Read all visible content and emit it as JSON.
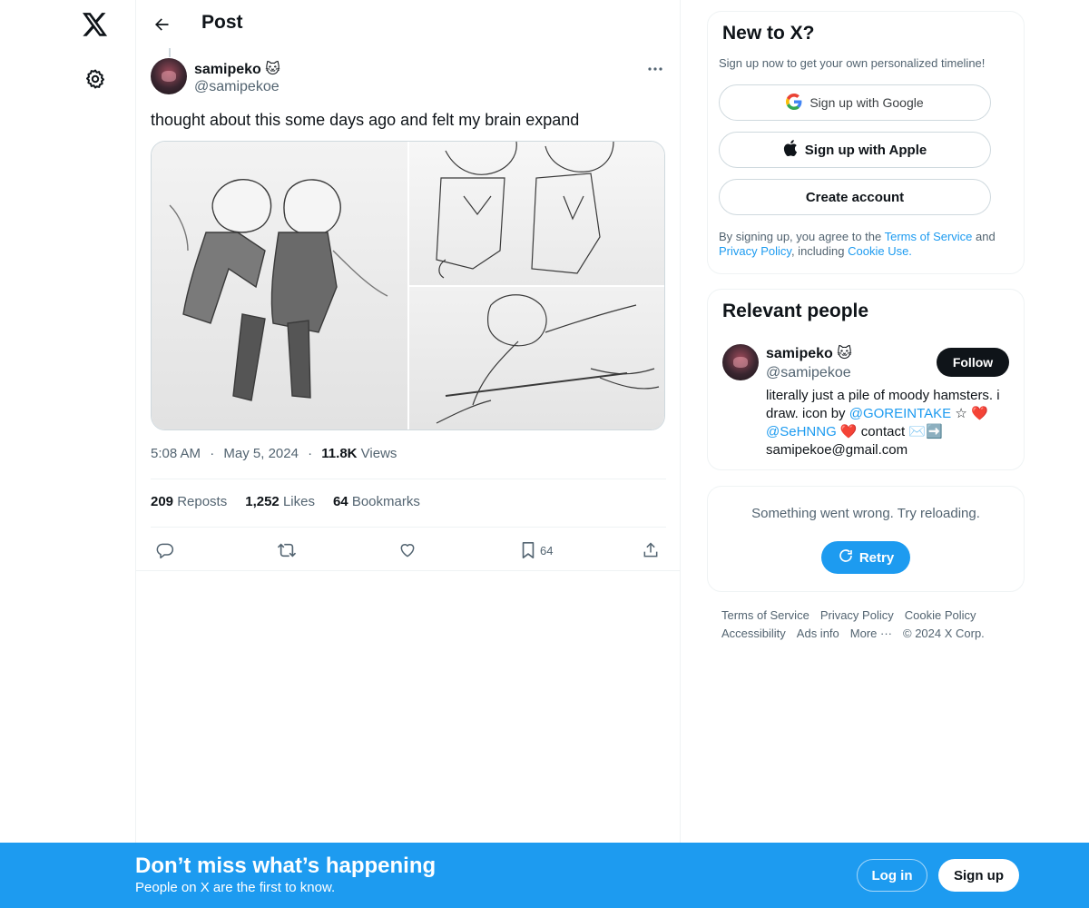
{
  "header": {
    "title": "Post"
  },
  "post": {
    "author_name": "samipeko 🐱",
    "author_handle": "@samipekoe",
    "text": "thought about this some days ago and felt my brain expand",
    "time": "5:08 AM",
    "dot": "·",
    "date": "May 5, 2024",
    "views_count": "11.8K",
    "views_label": " Views",
    "reposts_count": "209",
    "reposts_label": " Reposts",
    "likes_count": "1,252",
    "likes_label": " Likes",
    "bookmarks_count": "64",
    "bookmarks_label": " Bookmarks",
    "bookmark_action_count": "64"
  },
  "signup_card": {
    "title": "New to X?",
    "subtitle": "Sign up now to get your own personalized timeline!",
    "google_label": "Sign up with Google",
    "apple_label": "Sign up with Apple",
    "create_label": "Create account",
    "legal_prefix": "By signing up, you agree to the ",
    "terms_link": "Terms of Service",
    "legal_and": " and ",
    "privacy_link": "Privacy Policy",
    "legal_including": ", including ",
    "cookie_link": "Cookie Use."
  },
  "relevant_people": {
    "title": "Relevant people",
    "name": "samipeko 🐱",
    "handle": "@samipekoe",
    "follow_label": "Follow",
    "bio_1": "literally just a pile of moody hamsters. i draw. icon by ",
    "bio_link1": "@GOREINTAKE",
    "bio_2": " ☆ ❤️ ",
    "bio_link2": "@SeHNNG",
    "bio_3": " ❤️ contact ✉️➡️ samipekoe@gmail.com"
  },
  "error_card": {
    "message": "Something went wrong. Try reloading.",
    "retry_label": "Retry"
  },
  "footer": {
    "terms": "Terms of Service",
    "privacy": "Privacy Policy",
    "cookie": "Cookie Policy",
    "accessibility": "Accessibility",
    "ads": "Ads info",
    "more": "More ···",
    "copyright": "© 2024 X Corp."
  },
  "bottom_bar": {
    "title": "Don’t miss what’s happening",
    "subtitle": "People on X are the first to know.",
    "login_label": "Log in",
    "signup_label": "Sign up"
  },
  "colors": {
    "accent": "#1d9bf0",
    "text": "#0f1419",
    "secondary": "#536471",
    "border": "#eff3f4"
  }
}
